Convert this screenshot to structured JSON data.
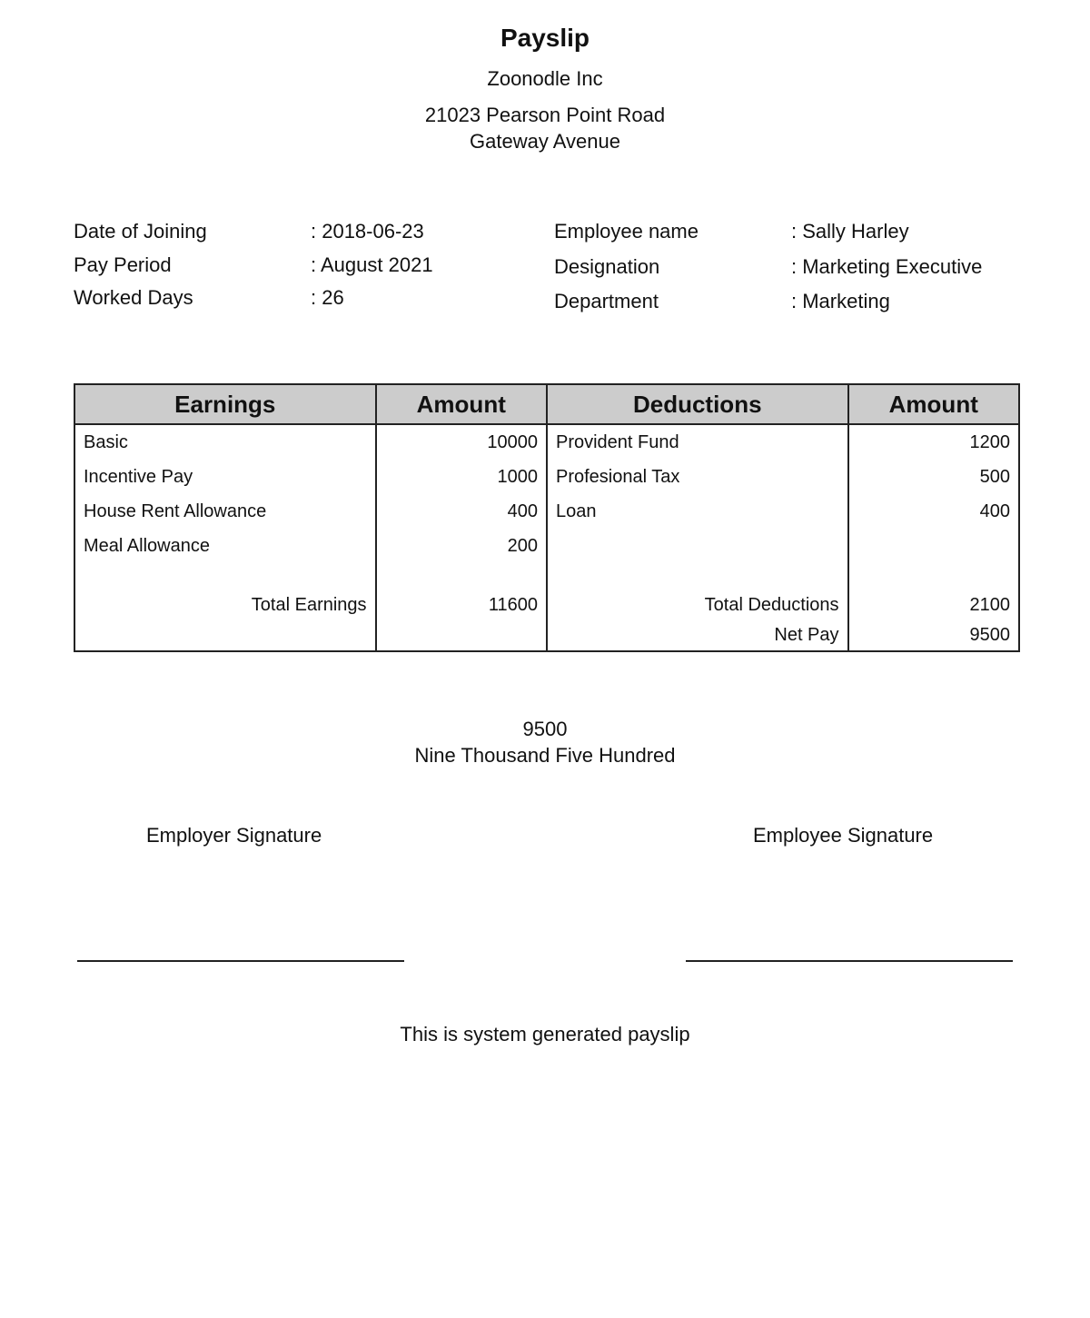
{
  "header": {
    "title": "Payslip",
    "company": "Zoonodle Inc",
    "address_line1": "21023 Pearson Point Road",
    "address_line2": "Gateway Avenue"
  },
  "info_left": [
    {
      "label": "Date of Joining",
      "value": ": 2018-06-23"
    },
    {
      "label": "Pay Period",
      "value": ": August 2021"
    },
    {
      "label": "Worked Days",
      "value": ": 26"
    }
  ],
  "info_right": [
    {
      "label": "Employee name",
      "value": ": Sally Harley"
    },
    {
      "label": "Designation",
      "value": ": Marketing Executive"
    },
    {
      "label": "Department",
      "value": ": Marketing"
    }
  ],
  "table": {
    "headers": [
      "Earnings",
      "Amount",
      "Deductions",
      "Amount"
    ],
    "rows": [
      {
        "earning": "Basic",
        "earning_amount": "10000",
        "deduction": "Provident Fund",
        "deduction_amount": "1200"
      },
      {
        "earning": "Incentive Pay",
        "earning_amount": "1000",
        "deduction": "Profesional Tax",
        "deduction_amount": "500"
      },
      {
        "earning": "House Rent Allowance",
        "earning_amount": "400",
        "deduction": "Loan",
        "deduction_amount": "400"
      },
      {
        "earning": "Meal Allowance",
        "earning_amount": "200",
        "deduction": "",
        "deduction_amount": ""
      }
    ],
    "total_earnings_label": "Total Earnings",
    "total_earnings": "11600",
    "total_deductions_label": "Total Deductions",
    "total_deductions": "2100",
    "net_pay_label": "Net Pay",
    "net_pay": "9500"
  },
  "net_summary": {
    "amount": "9500",
    "in_words": "Nine Thousand Five Hundred"
  },
  "signatures": {
    "employer": "Employer Signature",
    "employee": "Employee Signature"
  },
  "footer": "This is system generated payslip"
}
